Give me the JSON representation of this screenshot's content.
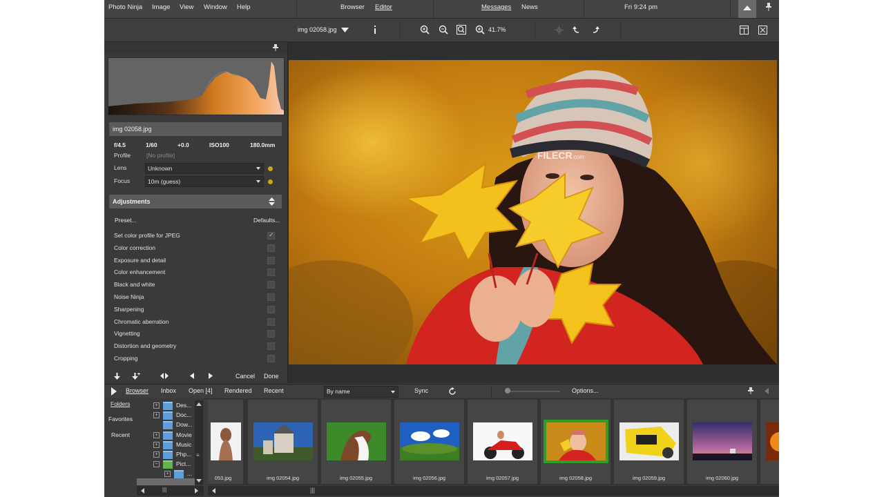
{
  "menubar": {
    "app_name": "Photo Ninja",
    "menus": [
      "Image",
      "View",
      "Window",
      "Help"
    ],
    "modes": [
      "Browser",
      "Editor"
    ],
    "active_mode": "Editor",
    "messages": "Messages",
    "news": "News",
    "clock": "Fri 9:24 pm"
  },
  "toolbar": {
    "filename": "img 02058.jpg",
    "zoom": "41.7%"
  },
  "info": {
    "filename": "img 02058.jpg",
    "aperture": "f/4.5",
    "shutter": "1/60",
    "exposure_comp": "+0.0",
    "iso": "ISO100",
    "focal_length": "180.0mm",
    "profile_label": "Profile",
    "profile_value": "[No profile]",
    "lens_label": "Lens",
    "lens_value": "Unknown",
    "focus_label": "Focus",
    "focus_value": "10m (guess)"
  },
  "adjustments": {
    "title": "Adjustments",
    "preset": "Preset...",
    "defaults": "Defaults...",
    "items": [
      {
        "label": "Set color profile for JPEG",
        "checked": true
      },
      {
        "label": "Color correction",
        "checked": false
      },
      {
        "label": "Exposure and detail",
        "checked": false
      },
      {
        "label": "Color enhancement",
        "checked": false
      },
      {
        "label": "Black and white",
        "checked": false
      },
      {
        "label": "Noise Ninja",
        "checked": false
      },
      {
        "label": "Sharpening",
        "checked": false
      },
      {
        "label": "Chromatic aberration",
        "checked": false
      },
      {
        "label": "Vignetting",
        "checked": false
      },
      {
        "label": "Distortion and geometry",
        "checked": false
      },
      {
        "label": "Cropping",
        "checked": false
      }
    ],
    "cancel": "Cancel",
    "done": "Done"
  },
  "watermark": {
    "brand": "FILECR",
    "suffix": ".com"
  },
  "browser": {
    "tabs": [
      "Browser",
      "Inbox",
      "Open [4]",
      "Rendered",
      "Recent"
    ],
    "active_tab": "Browser",
    "sort": "By name",
    "sync": "Sync",
    "options": "Options...",
    "nav": [
      "Folders",
      "Favorites",
      "Recent"
    ],
    "folders": [
      {
        "name": "Des...",
        "expander": "+"
      },
      {
        "name": "Doc...",
        "expander": "+"
      },
      {
        "name": "Dow...",
        "expander": ""
      },
      {
        "name": "Movie",
        "expander": "+"
      },
      {
        "name": "Music",
        "expander": "+"
      },
      {
        "name": "Php...",
        "expander": "+"
      },
      {
        "name": "Pict...",
        "expander": "−"
      },
      {
        "name": "...",
        "expander": "+"
      }
    ],
    "thumbnails": [
      "053.jpg",
      "img 02054.jpg",
      "img 02055.jpg",
      "img 02056.jpg",
      "img 02057.jpg",
      "img 02058.jpg",
      "img 02059.jpg",
      "img 02060.jpg"
    ],
    "selected_index": 5
  },
  "colors": {
    "accent_selection": "#2e9e26",
    "panel": "#3a3a3a",
    "chrome": "#444444"
  }
}
